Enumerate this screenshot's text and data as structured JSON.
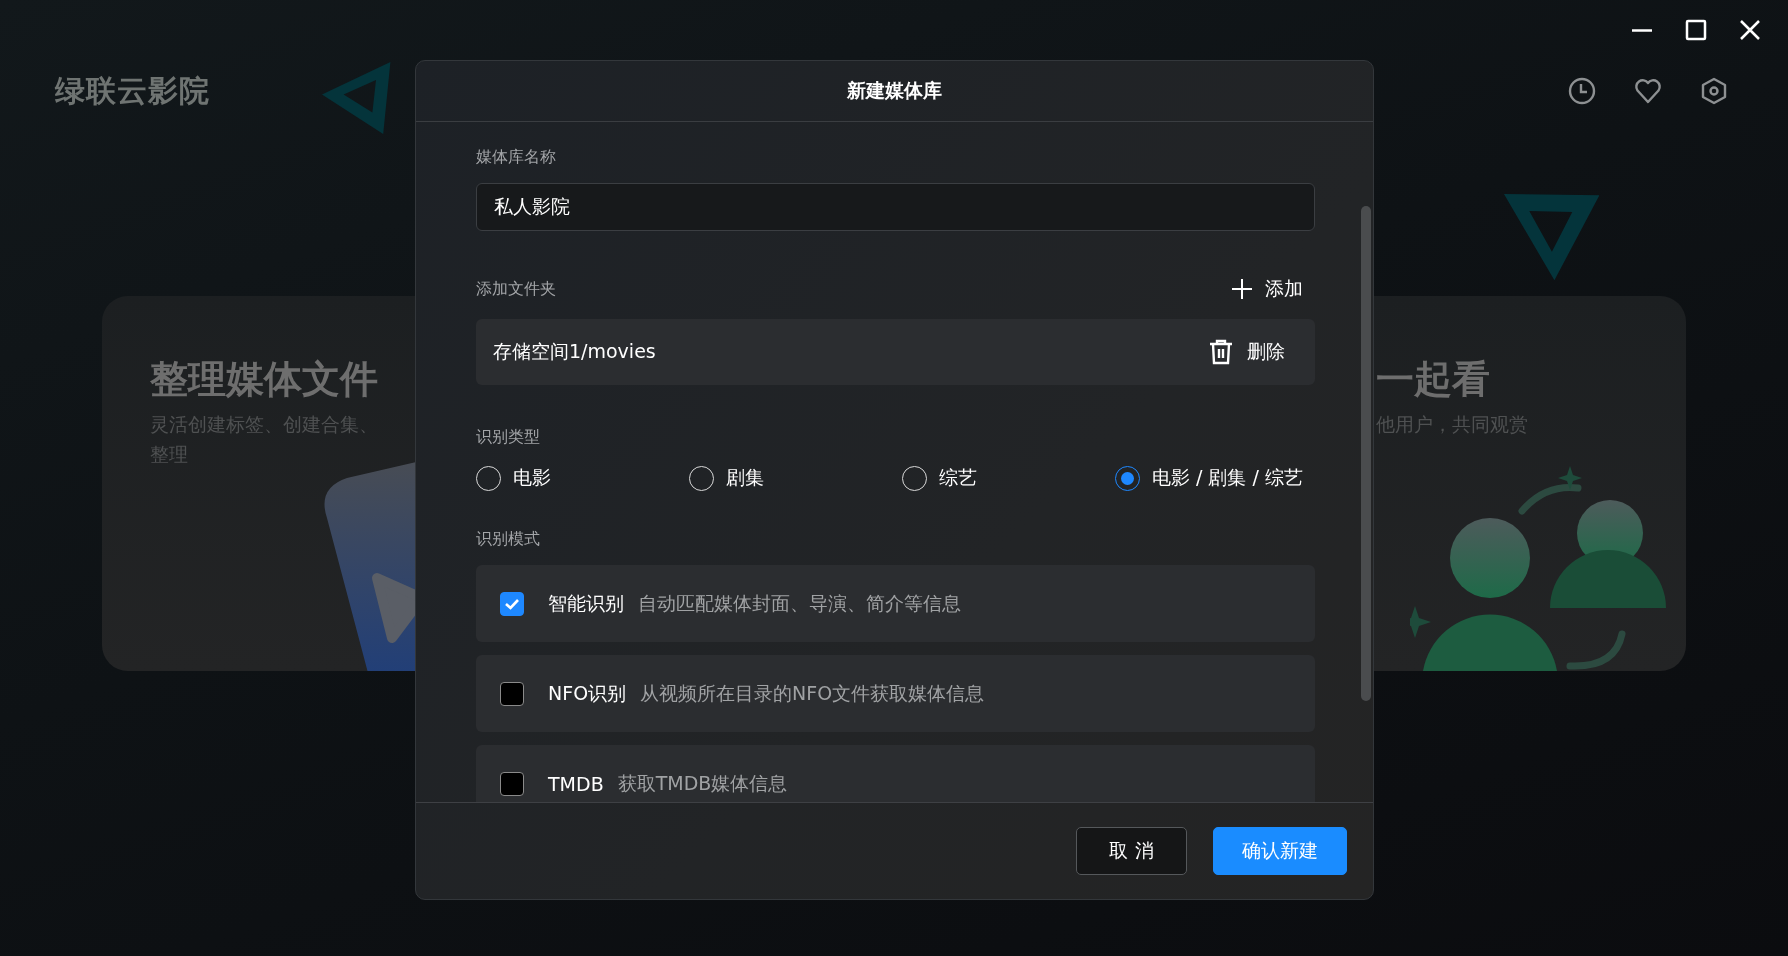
{
  "app": {
    "logo": "绿联云影院"
  },
  "background_cards": [
    {
      "kind": "media",
      "title": "整理媒体文件",
      "subtitle_lines": [
        "灵活创建标签、创建合集、",
        "整理"
      ]
    },
    {
      "kind": "people",
      "title": "一起看",
      "subtitle_lines": [
        "他用户，共同观赏"
      ]
    }
  ],
  "dialog": {
    "title": "新建媒体库",
    "name_field": {
      "label": "媒体库名称",
      "value": "私人影院"
    },
    "folders": {
      "label": "添加文件夹",
      "add_button": "添加",
      "items": [
        {
          "path": "存储空间1/movies",
          "delete_button": "删除"
        }
      ]
    },
    "type_group": {
      "label": "识别类型",
      "options": [
        {
          "label": "电影",
          "selected": false
        },
        {
          "label": "剧集",
          "selected": false
        },
        {
          "label": "综艺",
          "selected": false
        },
        {
          "label": "电影 / 剧集 / 综艺",
          "selected": true
        }
      ]
    },
    "mode_group": {
      "label": "识别模式",
      "options": [
        {
          "title": "智能识别",
          "description": "自动匹配媒体封面、导演、简介等信息",
          "checked": true
        },
        {
          "title": "NFO识别",
          "description": "从视频所在目录的NFO文件获取媒体信息",
          "checked": false
        },
        {
          "title": "TMDB",
          "description": "获取TMDB媒体信息",
          "checked": false
        }
      ]
    },
    "buttons": [
      {
        "label": "取 消",
        "kind": "secondary"
      },
      {
        "label": "确认新建",
        "kind": "primary"
      }
    ]
  }
}
